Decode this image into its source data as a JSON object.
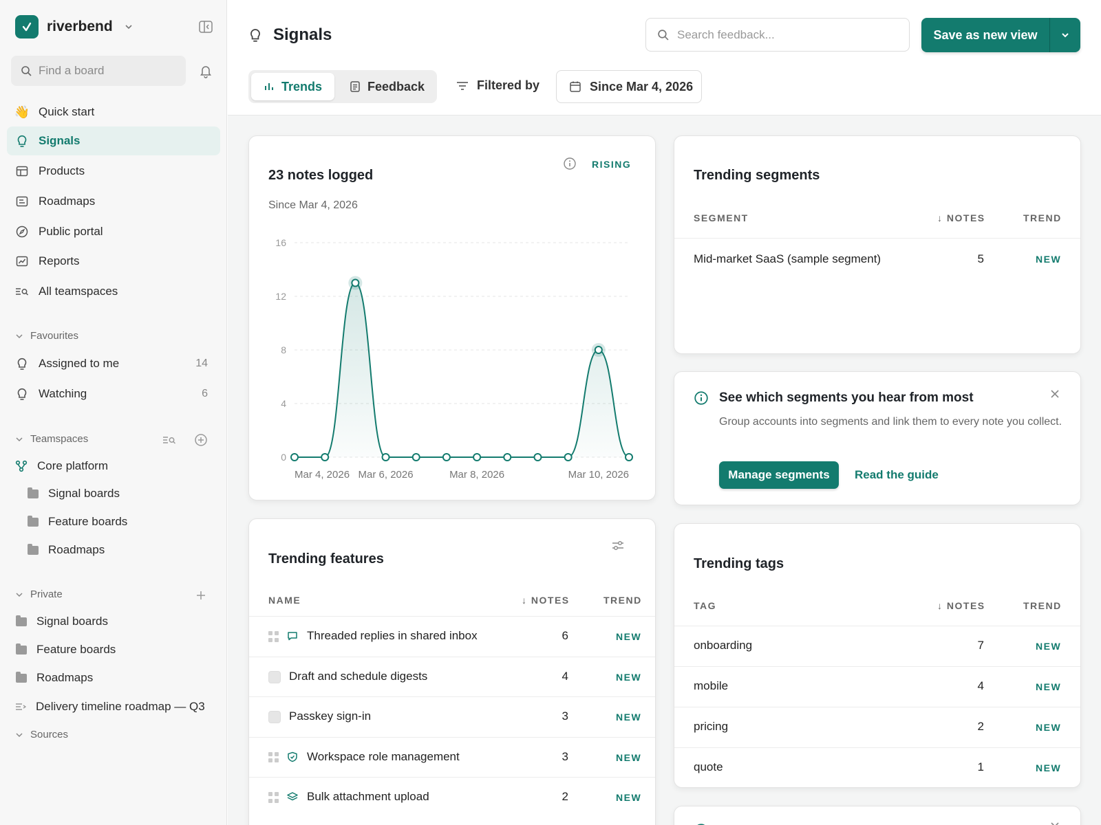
{
  "workspace": {
    "name": "riverbend"
  },
  "sidebar": {
    "find_placeholder": "Find a board",
    "nav": [
      {
        "label": "Quick start",
        "icon": "wave-hand-icon"
      },
      {
        "label": "Signals",
        "icon": "lightbulb-icon",
        "active": true
      },
      {
        "label": "Products",
        "icon": "products-icon"
      },
      {
        "label": "Roadmaps",
        "icon": "roadmap-icon"
      },
      {
        "label": "Public portal",
        "icon": "compass-icon"
      },
      {
        "label": "Reports",
        "icon": "chart-icon"
      },
      {
        "label": "All teamspaces",
        "icon": "list-search-icon"
      }
    ],
    "favourites": {
      "label": "Favourites",
      "items": [
        {
          "label": "Assigned to me",
          "count": "14"
        },
        {
          "label": "Watching",
          "count": "6"
        }
      ]
    },
    "teamspaces": {
      "label": "Teamspaces",
      "team": "Core platform",
      "items": [
        "Signal boards",
        "Feature boards",
        "Roadmaps"
      ]
    },
    "private": {
      "label": "Private",
      "items": [
        "Signal boards",
        "Feature boards",
        "Roadmaps",
        "Delivery timeline roadmap — Q3"
      ]
    },
    "sources": {
      "label": "Sources"
    }
  },
  "header": {
    "title": "Signals",
    "search_placeholder": "Search feedback...",
    "save_label": "Save as new view",
    "tabs": [
      "Trends",
      "Feedback"
    ],
    "filtered_by": "Filtered by",
    "date_filter": "Since Mar 4, 2026"
  },
  "notes_card": {
    "title": "23 notes logged",
    "subtitle": "Since Mar 4, 2026",
    "badge": "RISING"
  },
  "chart_data": {
    "type": "line",
    "x": [
      "Mar 4, 2026",
      "Mar 5, 2026",
      "Mar 6, 2026",
      "Mar 7, 2026",
      "Mar 8, 2026",
      "Mar 9, 2026",
      "Mar 10, 2026",
      "Mar 11, 2026"
    ],
    "x_points": [
      "Mar 4",
      "",
      "Mar 5",
      "",
      "Mar 6",
      "",
      "Mar 7",
      "",
      "Mar 8",
      "",
      "Mar 9",
      "",
      "Mar 10",
      ""
    ],
    "values": [
      0,
      0,
      13,
      0,
      0,
      0,
      0,
      0,
      0,
      0,
      8,
      0
    ],
    "xticks": [
      "Mar 4, 2026",
      "Mar 6, 2026",
      "Mar 8, 2026",
      "Mar 10, 2026"
    ],
    "yticks": [
      "16",
      "12",
      "8",
      "4",
      "0"
    ],
    "ylim": [
      0,
      16
    ],
    "grid": true,
    "color": "#137b6e"
  },
  "segments_card": {
    "title": "Trending segments",
    "cols": [
      "SEGMENT",
      "NOTES",
      "TREND"
    ],
    "rows": [
      {
        "name": "Mid-market SaaS (sample segment)",
        "notes": "5",
        "trend": "NEW"
      }
    ]
  },
  "info_card": {
    "title": "See which segments you hear from most",
    "body": "Group accounts into segments and link them to every note you collect.",
    "primary": "Manage segments",
    "secondary": "Read the guide"
  },
  "features_card": {
    "title": "Trending features",
    "cols": [
      "NAME",
      "NOTES",
      "TREND"
    ],
    "rows": [
      {
        "name": "Threaded replies in shared inbox",
        "notes": "6",
        "trend": "NEW",
        "icon": "chat-icon"
      },
      {
        "name": "Draft and schedule digests",
        "notes": "4",
        "trend": "NEW",
        "icon": ""
      },
      {
        "name": "Passkey sign-in",
        "notes": "3",
        "trend": "NEW",
        "icon": ""
      },
      {
        "name": "Workspace role management",
        "notes": "3",
        "trend": "NEW",
        "icon": "shield-icon"
      },
      {
        "name": "Bulk attachment upload",
        "notes": "2",
        "trend": "NEW",
        "icon": "layers-icon"
      }
    ]
  },
  "tags_card": {
    "title": "Trending tags",
    "cols": [
      "TAG",
      "NOTES",
      "TREND"
    ],
    "rows": [
      {
        "name": "onboarding",
        "notes": "7",
        "trend": "NEW"
      },
      {
        "name": "mobile",
        "notes": "4",
        "trend": "NEW"
      },
      {
        "name": "pricing",
        "notes": "2",
        "trend": "NEW"
      },
      {
        "name": "quote",
        "notes": "1",
        "trend": "NEW"
      }
    ]
  }
}
